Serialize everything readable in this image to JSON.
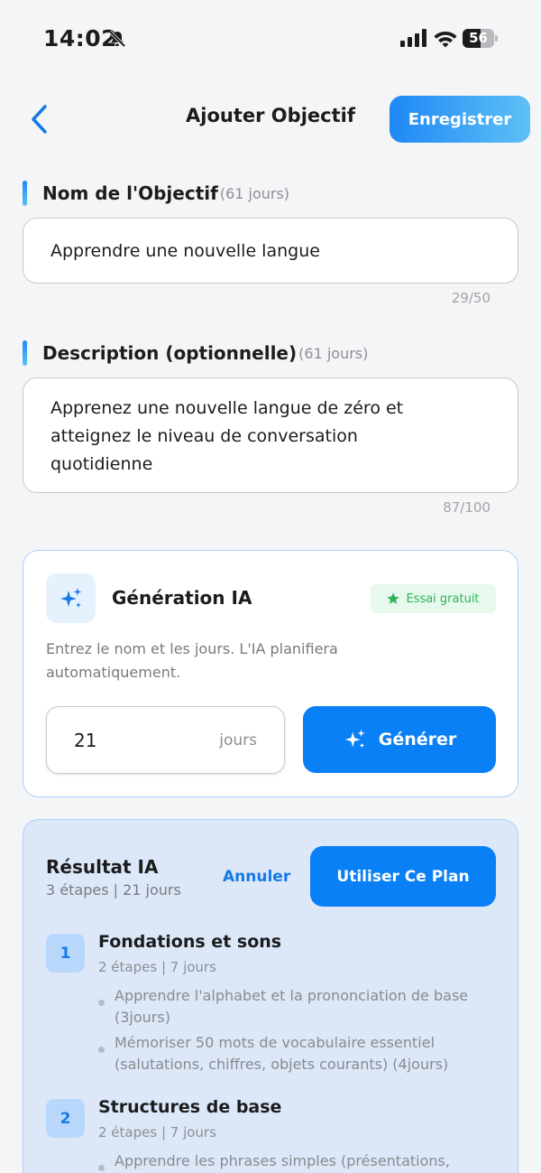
{
  "status_bar": {
    "time": "14:02",
    "battery": "56"
  },
  "header": {
    "title": "Ajouter Objectif",
    "save_label": "Enregistrer"
  },
  "name_section": {
    "label": "Nom de l'Objectif",
    "sub": "(61 jours)",
    "value": "Apprendre une nouvelle langue",
    "counter": "29/50"
  },
  "description_section": {
    "label": "Description (optionnelle)",
    "sub": "(61 jours)",
    "value": "Apprenez une nouvelle langue de zéro et atteignez le niveau de conversation quotidienne",
    "counter": "87/100"
  },
  "ai_card": {
    "title": "Génération IA",
    "badge": "Essai gratuit",
    "description": "Entrez le nom et les jours. L'IA planifiera automatiquement.",
    "days_value": "21",
    "days_unit": "jours",
    "generate_label": "Générer"
  },
  "result": {
    "title": "Résultat IA",
    "summary": "3 étapes | 21 jours",
    "cancel_label": "Annuler",
    "use_label": "Utiliser Ce Plan",
    "steps": [
      {
        "number": "1",
        "title": "Fondations et sons",
        "meta": "2 étapes | 7 jours",
        "tasks": [
          "Apprendre l'alphabet et la prononciation de base (3jours)",
          "Mémoriser 50 mots de vocabulaire essentiel (salutations, chiffres, objets courants) (4jours)"
        ]
      },
      {
        "number": "2",
        "title": "Structures de base",
        "meta": "2 étapes | 7 jours",
        "tasks": [
          "Apprendre les phrases simples (présentations,"
        ]
      }
    ]
  },
  "colors": {
    "accent": "#0a80f6",
    "badge_green": "#2db35a"
  }
}
